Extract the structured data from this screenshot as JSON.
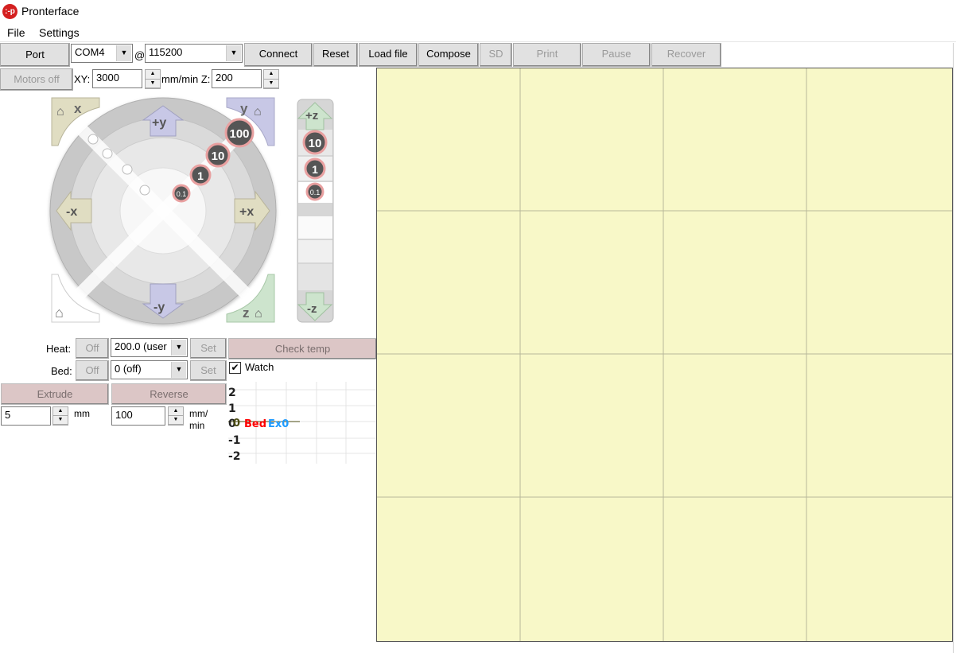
{
  "window": {
    "title": "Pronterface",
    "logo_text": ":-p"
  },
  "menu": [
    "File",
    "Settings"
  ],
  "toolbar": {
    "port": "Port",
    "port_value": "COM4",
    "at": "@",
    "baud_value": "115200",
    "connect": "Connect",
    "reset": "Reset",
    "load_file": "Load file",
    "compose": "Compose",
    "sd": "SD",
    "print": "Print",
    "pause": "Pause",
    "recover": "Recover"
  },
  "motion": {
    "motors_off": "Motors off",
    "xy_label": "XY:",
    "xy_value": "3000",
    "xy_unit": "mm/min Z:",
    "z_value": "200"
  },
  "jog": {
    "home_x": "x",
    "home_y": "y",
    "home_z": "z",
    "plus_y": "+y",
    "minus_y": "-y",
    "plus_x": "+x",
    "minus_x": "-x",
    "plus_z": "+z",
    "minus_z": "-z",
    "steps": [
      "100",
      "10",
      "1",
      "0.1"
    ],
    "z_steps": [
      "10",
      "1",
      "0.1"
    ]
  },
  "temp": {
    "heat_label": "Heat:",
    "bed_label": "Bed:",
    "off": "Off",
    "heat_value": "200.0 (user",
    "bed_value": "0 (off)",
    "set": "Set",
    "check_temp": "Check temp",
    "watch": "Watch",
    "watch_checked": true
  },
  "extrude": {
    "extrude": "Extrude",
    "reverse": "Reverse",
    "length": "5",
    "length_unit": "mm",
    "speed": "100",
    "speed_unit": "mm/\nmin"
  },
  "graph": {
    "y_ticks": [
      "2",
      "1",
      "0",
      "-1",
      "-2"
    ],
    "legend": [
      {
        "name": "0",
        "color": "#4a4a10"
      },
      {
        "name": "Bed",
        "color": "#ff0000"
      },
      {
        "name": "Ex0",
        "color": "#1e9bff"
      }
    ]
  },
  "colors": {
    "plate": "#f8f8c8",
    "plate_grid": "#b8b89a",
    "button_pink": "#dcc6c6"
  }
}
